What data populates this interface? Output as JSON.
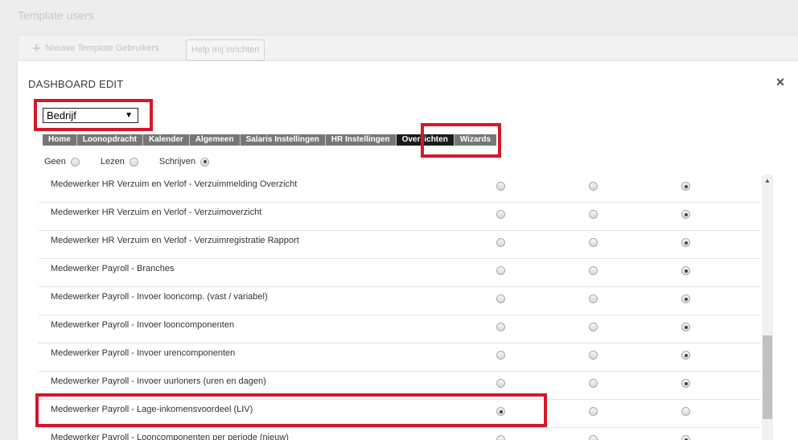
{
  "background": {
    "title": "Template users",
    "new_button": "Nieuwe Template Gebruikers",
    "help_button": "Help mij inrichten"
  },
  "modal": {
    "title": "DASHBOARD EDIT",
    "close_icon": "close-icon",
    "select_value": "Bedrijf",
    "tabs": [
      {
        "label": "Home"
      },
      {
        "label": "Loonopdracht"
      },
      {
        "label": "Kalender"
      },
      {
        "label": "Algemeen"
      },
      {
        "label": "Salaris Instellingen"
      },
      {
        "label": "HR Instellingen"
      },
      {
        "label": "Overzichten",
        "active": true
      },
      {
        "label": "Wizards"
      }
    ],
    "legend": [
      "Geen",
      "Lezen",
      "Schrijven"
    ],
    "legend_selected": 2,
    "rows": [
      {
        "label": "Medewerker HR Verzuim en Verlof - Verzuimmelding Overzicht",
        "selected": 2
      },
      {
        "label": "Medewerker HR Verzuim en Verlof - Verzuimoverzicht",
        "selected": 2
      },
      {
        "label": "Medewerker HR Verzuim en Verlof - Verzuimregistratie Rapport",
        "selected": 2
      },
      {
        "label": "Medewerker Payroll - Branches",
        "selected": 2
      },
      {
        "label": "Medewerker Payroll - Invoer looncomp. (vast / variabel)",
        "selected": 2
      },
      {
        "label": "Medewerker Payroll - Invoer looncomponenten",
        "selected": 2
      },
      {
        "label": "Medewerker Payroll - Invoer urencomponenten",
        "selected": 2
      },
      {
        "label": "Medewerker Payroll - Invoer uurloners (uren en dagen)",
        "selected": 2
      },
      {
        "label": "Medewerker Payroll - Lage-inkomensvoordeel (LIV)",
        "selected": 0
      },
      {
        "label": "Medewerker Payroll - Looncomponenten per periode (nieuw)",
        "selected": 2
      }
    ]
  },
  "colors": {
    "highlight": "#d4182a",
    "tab_bar": "#767676",
    "tab_active": "#1b1b1b"
  }
}
